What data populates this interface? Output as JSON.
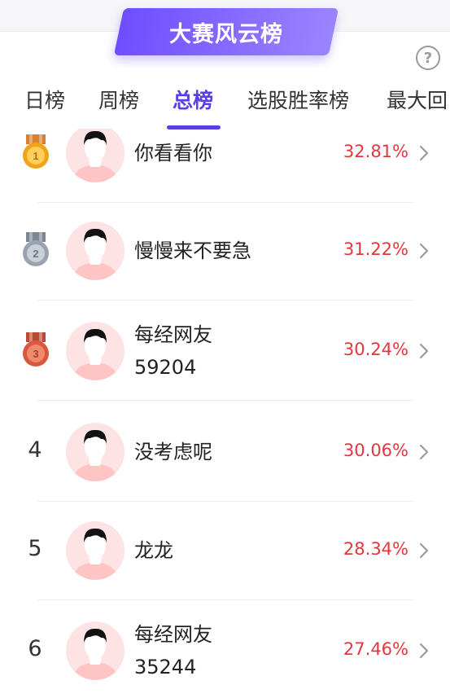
{
  "header": {
    "title": "大赛风云榜",
    "help_symbol": "?"
  },
  "tabs": [
    {
      "label": "日榜"
    },
    {
      "label": "周榜"
    },
    {
      "label": "总榜"
    },
    {
      "label": "选股胜率榜"
    },
    {
      "label": "最大回"
    }
  ],
  "active_tab": "总榜",
  "colors": {
    "accent": "#5b3fe6",
    "percent": "#e5363d",
    "gold": "#f2a31b",
    "silver": "#9aa3ad",
    "bronze": "#d9583e"
  },
  "rankings": [
    {
      "rank": "1",
      "medal": "gold-medal-icon",
      "medal_number": "1",
      "name": "你看看你",
      "name2": "",
      "percent": "32.81%"
    },
    {
      "rank": "2",
      "medal": "silver-medal-icon",
      "medal_number": "2",
      "name": "慢慢来不要急",
      "name2": "",
      "percent": "31.22%"
    },
    {
      "rank": "3",
      "medal": "bronze-medal-icon",
      "medal_number": "3",
      "name": "每经网友",
      "name2": "59204",
      "percent": "30.24%"
    },
    {
      "rank": "4",
      "medal": "",
      "name": "没考虑呢",
      "name2": "",
      "percent": "30.06%"
    },
    {
      "rank": "5",
      "medal": "",
      "name": "龙龙",
      "name2": "",
      "percent": "28.34%"
    },
    {
      "rank": "6",
      "medal": "",
      "name": "每经网友",
      "name2": "35244",
      "percent": "27.46%"
    }
  ]
}
